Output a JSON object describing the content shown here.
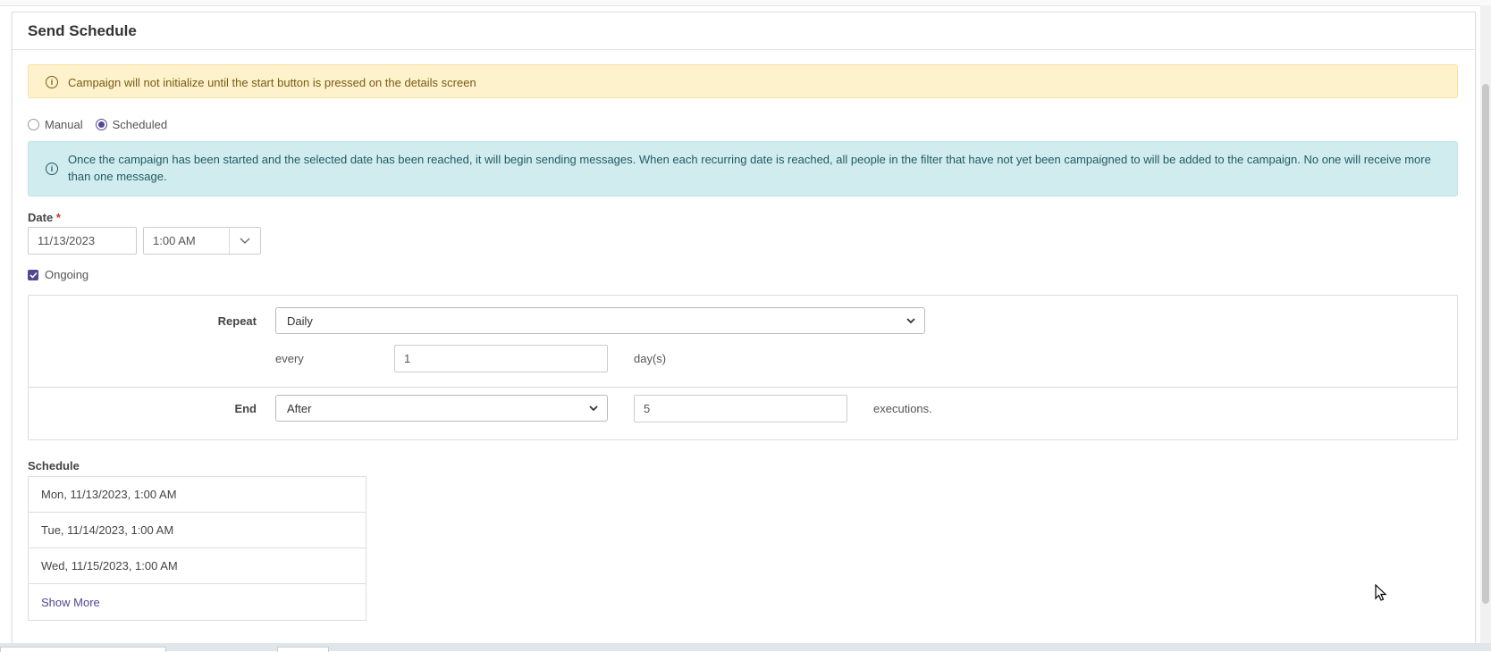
{
  "panel": {
    "title": "Send Schedule"
  },
  "warning_alert": {
    "icon": "info-circle-icon",
    "text": "Campaign will not initialize until the start button is pressed on the details screen"
  },
  "mode": {
    "options": [
      {
        "label": "Manual",
        "checked": false
      },
      {
        "label": "Scheduled",
        "checked": true
      }
    ]
  },
  "info_alert": {
    "icon": "info-circle-icon",
    "text": "Once the campaign has been started and the selected date has been reached, it will begin sending messages. When each recurring date is reached, all people in the filter that have not yet been campaigned to will be added to the campaign. No one will receive more than one message."
  },
  "date_field": {
    "label": "Date",
    "required_mark": "*",
    "date_value": "11/13/2023",
    "time_value": "1:00 AM"
  },
  "ongoing": {
    "label": "Ongoing",
    "checked": true
  },
  "repeat": {
    "label": "Repeat",
    "value": "Daily",
    "every_label": "every",
    "every_value": "1",
    "unit_label": "day(s)"
  },
  "end": {
    "label": "End",
    "value": "After",
    "count_value": "5",
    "suffix_label": "executions."
  },
  "schedule": {
    "label": "Schedule",
    "items": [
      "Mon, 11/13/2023, 1:00 AM",
      "Tue, 11/14/2023, 1:00 AM",
      "Wed, 11/15/2023, 1:00 AM"
    ],
    "show_more_label": "Show More"
  },
  "colors": {
    "accent": "#544691",
    "warning_bg": "#fdf2cc",
    "info_bg": "#d1ecee"
  }
}
